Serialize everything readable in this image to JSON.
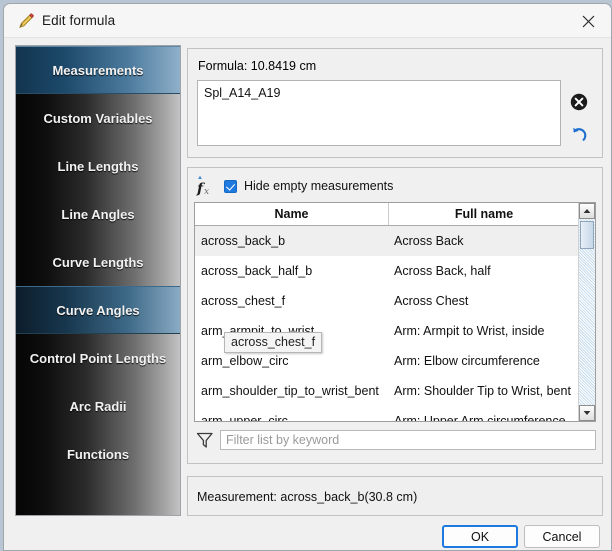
{
  "window": {
    "title": "Edit formula",
    "title_icon": "pencil-icon",
    "close_icon": "close-icon"
  },
  "sidebar": {
    "items": [
      {
        "label": "Measurements",
        "state": "selected"
      },
      {
        "label": "Custom Variables",
        "state": "normal"
      },
      {
        "label": "Line Lengths",
        "state": "normal"
      },
      {
        "label": "Line Angles",
        "state": "normal"
      },
      {
        "label": "Curve Lengths",
        "state": "normal"
      },
      {
        "label": "Curve Angles",
        "state": "hovered"
      },
      {
        "label": "Control Point Lengths",
        "state": "normal"
      },
      {
        "label": "Arc Radii",
        "state": "normal"
      },
      {
        "label": "Functions",
        "state": "normal"
      }
    ]
  },
  "formula": {
    "label": "Formula:  10.8419 cm",
    "value": "Spl_A14_A19",
    "clear_icon": "clear-circle-icon",
    "undo_icon": "undo-arrow-icon"
  },
  "list_panel": {
    "fx_icon": "fx-function-icon",
    "hide_empty_label": "Hide empty measurements",
    "hide_empty_checked": true,
    "columns": [
      "Name",
      "Full name"
    ],
    "rows": [
      {
        "name": "across_back_b",
        "full": "Across Back",
        "selected": true
      },
      {
        "name": "across_back_half_b",
        "full": "Across Back, half",
        "selected": false
      },
      {
        "name": "across_chest_f",
        "full": "Across Chest",
        "selected": false
      },
      {
        "name": "arm_armpit_to_wrist",
        "full": "Arm: Armpit to Wrist, inside",
        "selected": false
      },
      {
        "name": "arm_elbow_circ",
        "full": "Arm: Elbow circumference",
        "selected": false
      },
      {
        "name": "arm_shoulder_tip_to_wrist_bent",
        "full": "Arm: Shoulder Tip to Wrist, bent",
        "selected": false
      },
      {
        "name": "arm_upper_circ",
        "full": "Arm: Upper Arm circumference",
        "selected": false
      }
    ],
    "tooltip": "across_chest_f",
    "scroll_up_icon": "scroll-up-arrow-icon",
    "scroll_down_icon": "scroll-down-arrow-icon"
  },
  "filter": {
    "icon": "funnel-filter-icon",
    "placeholder": "Filter list by keyword",
    "value": ""
  },
  "status": {
    "text": "Measurement: across_back_b(30.8 cm)"
  },
  "buttons": {
    "ok": "OK",
    "cancel": "Cancel"
  },
  "colors": {
    "accent": "#1f7ae0",
    "selected_nav": "#1d4a6b",
    "window_bg": "#f0f0f0",
    "desktop_bg": "#b9c5d2"
  }
}
